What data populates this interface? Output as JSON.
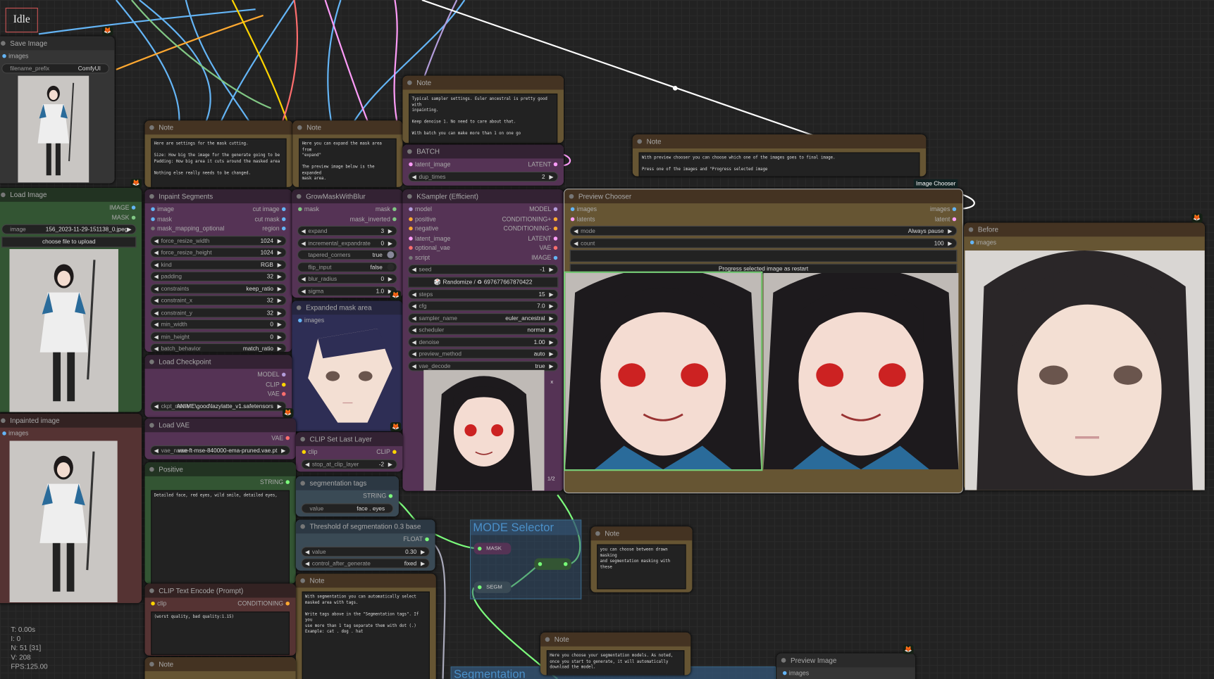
{
  "status": "Idle",
  "stats": {
    "t": "T: 0.00s",
    "i": "I: 0",
    "n": "N: 51 [31]",
    "v": "V: 208",
    "fps": "FPS:125.00"
  },
  "colors": {
    "image": "#64b5f6",
    "mask": "#81c784",
    "gray": "#777777",
    "model": "#b39ddb",
    "cond": "#ffa931",
    "latent": "#ff9cf9",
    "vae": "#ff6e6e",
    "clip": "#ffd500",
    "string": "#7cfc7c"
  },
  "groups": {
    "mode_selector": "MODE Selector",
    "segmentation": "Segmentation"
  },
  "reroutes": {
    "mask": "MASK",
    "segm": "SEGM"
  },
  "image_chooser_badge": "Image Chooser",
  "ksampler_pager": {
    "close": "x",
    "page": "1/2"
  },
  "nodes": {
    "save_image": {
      "title": "Save Image",
      "slots": [
        {
          "in": "images",
          "ic": "#64b5f6"
        }
      ],
      "widgets": [
        {
          "t": "tx",
          "label": "filename_prefix",
          "value": "ComfyUI"
        }
      ]
    },
    "load_image": {
      "title": "Load Image",
      "slots": [
        {
          "out": "IMAGE",
          "oc": "#64b5f6"
        },
        {
          "out": "MASK",
          "oc": "#81c784"
        }
      ],
      "widgets": [
        {
          "t": "tx",
          "label": "image",
          "value": "156_2023-11-29-151138_0.jpeg"
        },
        {
          "t": "btn",
          "label": "choose file to upload"
        }
      ]
    },
    "inpainted_image": {
      "title": "Inpainted image",
      "slots": [
        {
          "in": "images",
          "ic": "#64b5f6"
        }
      ]
    },
    "note_mask": {
      "title": "Note",
      "text": "Here are settings for the mask cutting.\n\nSize: How big the image for the generate going to be\nPadding: How big area it cuts around the masked area\n\nNothing else really needs to be changed."
    },
    "note_expand": {
      "title": "Note",
      "text": "Here you can expand the mask area from\n\"expand\"\n\nThe preview image below is the expanded\nmask area."
    },
    "note_sampler": {
      "title": "Note",
      "text": "Typical sampler settings. Euler ancestral is pretty good with\ninpainting.\n\nKeep denoise 1. No need to care about that.\n\nWith batch you can make more than 1 on one go"
    },
    "batch": {
      "title": "BATCH",
      "slots": [
        {
          "in": "latent_image",
          "ic": "#ff9cf9",
          "out": "LATENT",
          "oc": "#ff9cf9"
        }
      ],
      "widgets": [
        {
          "label": "dup_times",
          "value": "2"
        }
      ]
    },
    "note_chooser": {
      "title": "Note",
      "text": "With preview chooser you can choose which one of the images goes to final image.\n\nPress one of the images and \"Progress selected image"
    },
    "inpaint_segments": {
      "title": "Inpaint Segments",
      "slots": [
        {
          "in": "image",
          "ic": "#64b5f6",
          "out": "cut image",
          "oc": "#64b5f6"
        },
        {
          "in": "mask",
          "ic": "#64b5f6",
          "out": "cut mask",
          "oc": "#64b5f6"
        },
        {
          "in": "mask_mapping_optional",
          "ic": "#777",
          "out": "region",
          "oc": "#64b5f6"
        }
      ],
      "widgets": [
        {
          "label": "force_resize_width",
          "value": "1024"
        },
        {
          "label": "force_resize_height",
          "value": "1024"
        },
        {
          "label": "kind",
          "value": "RGB"
        },
        {
          "label": "padding",
          "value": "32"
        },
        {
          "label": "constraints",
          "value": "keep_ratio"
        },
        {
          "label": "constraint_x",
          "value": "32"
        },
        {
          "label": "constraint_y",
          "value": "32"
        },
        {
          "label": "min_width",
          "value": "0"
        },
        {
          "label": "min_height",
          "value": "0"
        },
        {
          "label": "batch_behavior",
          "value": "match_ratio"
        }
      ]
    },
    "grow_mask": {
      "title": "GrowMaskWithBlur",
      "slots": [
        {
          "in": "mask",
          "ic": "#81c784",
          "out": "mask",
          "oc": "#81c784"
        },
        {
          "out": "mask_inverted",
          "oc": "#81c784"
        }
      ],
      "widgets": [
        {
          "label": "expand",
          "value": "3"
        },
        {
          "label": "incremental_expandrate",
          "value": "0"
        },
        {
          "t": "tg",
          "label": "tapered_corners",
          "value": "true"
        },
        {
          "t": "tg off",
          "label": "flip_input",
          "value": "false"
        },
        {
          "label": "blur_radius",
          "value": "0"
        },
        {
          "label": "sigma",
          "value": "1.0"
        }
      ]
    },
    "expanded_mask": {
      "title": "Expanded mask area",
      "slots": [
        {
          "in": "images",
          "ic": "#64b5f6"
        }
      ]
    },
    "ksampler": {
      "title": "KSampler (Efficient)",
      "slots": [
        {
          "in": "model",
          "ic": "#b39ddb",
          "out": "MODEL",
          "oc": "#b39ddb"
        },
        {
          "in": "positive",
          "ic": "#ffa931",
          "out": "CONDITIONING+",
          "oc": "#ffa931"
        },
        {
          "in": "negative",
          "ic": "#ffa931",
          "out": "CONDITIONING-",
          "oc": "#ffa931"
        },
        {
          "in": "latent_image",
          "ic": "#ff9cf9",
          "out": "LATENT",
          "oc": "#ff9cf9"
        },
        {
          "in": "optional_vae",
          "ic": "#ff6e6e",
          "out": "VAE",
          "oc": "#ff6e6e"
        },
        {
          "in": "script",
          "ic": "#777",
          "out": "IMAGE",
          "oc": "#64b5f6"
        }
      ],
      "widgets": [
        {
          "label": "seed",
          "value": "-1"
        },
        {
          "t": "btn",
          "label": "🎲 Randomize / ♻ 697677667870422"
        },
        {
          "label": "steps",
          "value": "15"
        },
        {
          "label": "cfg",
          "value": "7.0"
        },
        {
          "label": "sampler_name",
          "value": "euler_ancestral"
        },
        {
          "label": "scheduler",
          "value": "normal"
        },
        {
          "label": "denoise",
          "value": "1.00"
        },
        {
          "label": "preview_method",
          "value": "auto"
        },
        {
          "label": "vae_decode",
          "value": "true"
        }
      ]
    },
    "load_checkpoint": {
      "title": "Load Checkpoint",
      "slots": [
        {
          "out": "MODEL",
          "oc": "#b39ddb"
        },
        {
          "out": "CLIP",
          "oc": "#ffd500"
        },
        {
          "out": "VAE",
          "oc": "#ff6e6e"
        }
      ],
      "widgets": [
        {
          "label": "ckpt_name",
          "value": "ANIME\\good\\lazylatte_v1.safetensors"
        }
      ]
    },
    "load_vae": {
      "title": "Load VAE",
      "slots": [
        {
          "out": "VAE",
          "oc": "#ff6e6e"
        }
      ],
      "widgets": [
        {
          "label": "vae_name",
          "value": "vae-ft-mse-840000-ema-pruned.vae.pt"
        }
      ]
    },
    "clip_last_layer": {
      "title": "CLIP Set Last Layer",
      "slots": [
        {
          "in": "clip",
          "ic": "#ffd500",
          "out": "CLIP",
          "oc": "#ffd500"
        }
      ],
      "widgets": [
        {
          "label": "stop_at_clip_layer",
          "value": "-2"
        }
      ]
    },
    "positive": {
      "title": "Positive",
      "slots": [
        {
          "out": "STRING",
          "oc": "#7cfc7c"
        }
      ],
      "text": "Detailed face, red eyes, wild smile, detailed eyes,"
    },
    "seg_tags": {
      "title": "segmentation tags",
      "slots": [
        {
          "out": "STRING",
          "oc": "#7cfc7c"
        }
      ],
      "widgets": [
        {
          "t": "tx",
          "label": "value",
          "value": "face . eyes"
        }
      ]
    },
    "threshold": {
      "title": "Threshold of segmentation 0.3 base",
      "slots": [
        {
          "out": "FLOAT",
          "oc": "#7cfc7c"
        }
      ],
      "widgets": [
        {
          "label": "value",
          "value": "0.30"
        },
        {
          "label": "control_after_generate",
          "value": "fixed"
        }
      ]
    },
    "note_seg": {
      "title": "Note",
      "text": "With segmentation you can automatically select\nmasked area with tags.\n\nWrite tags above in the \"Segmentation tags\". If you\nuse more than 1 tag separate them with dot (.)\nExample: cat . dog . hat"
    },
    "clip_encode": {
      "title": "CLIP Text Encode (Prompt)",
      "slots": [
        {
          "in": "clip",
          "ic": "#ffd500",
          "out": "CONDITIONING",
          "oc": "#ffa931"
        }
      ],
      "text": "(worst quality, bad quality:1.15)"
    },
    "note_bottom": {
      "title": "Note"
    },
    "note_mode": {
      "title": "Note",
      "text": "you can choose between drawn masking\nand segmentation masking with these"
    },
    "note_models": {
      "title": "Note",
      "text": "Here you choose your segmentation models. As noted,\nonce you start to generate, it will automatically\ndownload the model."
    },
    "preview_image": {
      "title": "Preview Image",
      "slots": [
        {
          "in": "images",
          "ic": "#64b5f6"
        }
      ]
    },
    "preview_chooser": {
      "title": "Preview Chooser",
      "slots": [
        {
          "in": "images",
          "ic": "#64b5f6",
          "out": "images",
          "oc": "#64b5f6"
        },
        {
          "in": "latents",
          "ic": "#ff9cf9",
          "out": "latent",
          "oc": "#ff9cf9"
        }
      ],
      "widgets": [
        {
          "label": "mode",
          "value": "Always pause"
        },
        {
          "label": "count",
          "value": "100"
        },
        {
          "t": "empty"
        },
        {
          "t": "btn",
          "label": "Progress selected image as restart"
        }
      ]
    },
    "before": {
      "title": "Before",
      "slots": [
        {
          "in": "images",
          "ic": "#64b5f6"
        }
      ]
    }
  }
}
